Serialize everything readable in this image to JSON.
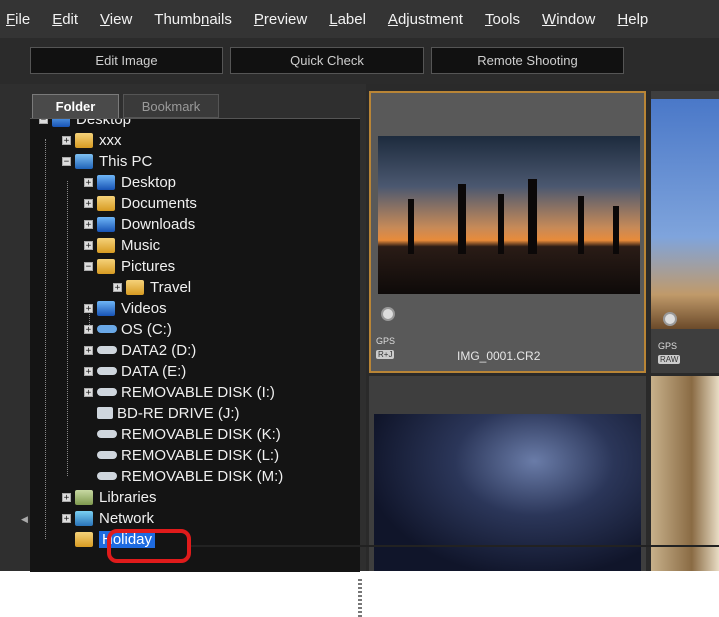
{
  "menu": [
    {
      "pre": "",
      "u": "F",
      "post": "ile"
    },
    {
      "pre": "",
      "u": "E",
      "post": "dit"
    },
    {
      "pre": "",
      "u": "V",
      "post": "iew"
    },
    {
      "pre": "Thumb",
      "u": "n",
      "post": "ails"
    },
    {
      "pre": "",
      "u": "P",
      "post": "review"
    },
    {
      "pre": "",
      "u": "L",
      "post": "abel"
    },
    {
      "pre": "",
      "u": "A",
      "post": "djustment"
    },
    {
      "pre": "",
      "u": "T",
      "post": "ools"
    },
    {
      "pre": "",
      "u": "W",
      "post": "indow"
    },
    {
      "pre": "",
      "u": "H",
      "post": "elp"
    }
  ],
  "toolbar": {
    "edit_image": "Edit Image",
    "quick_check": "Quick Check",
    "remote_shooting": "Remote Shooting"
  },
  "tabs": {
    "folder": "Folder",
    "bookmark": "Bookmark"
  },
  "tree": [
    {
      "label": "Desktop"
    },
    {
      "label": "xxx"
    },
    {
      "label": "This PC"
    },
    {
      "label": "Desktop"
    },
    {
      "label": "Documents"
    },
    {
      "label": "Downloads"
    },
    {
      "label": "Music"
    },
    {
      "label": "Pictures"
    },
    {
      "label": "Travel"
    },
    {
      "label": "Videos"
    },
    {
      "label": "OS (C:)"
    },
    {
      "label": "DATA2 (D:)"
    },
    {
      "label": "DATA (E:)"
    },
    {
      "label": "REMOVABLE DISK (I:)"
    },
    {
      "label": "BD-RE DRIVE (J:)"
    },
    {
      "label": "REMOVABLE DISK (K:)"
    },
    {
      "label": "REMOVABLE DISK (L:)"
    },
    {
      "label": "REMOVABLE DISK (M:)"
    },
    {
      "label": "Libraries"
    },
    {
      "label": "Network"
    },
    {
      "label": "Holiday"
    }
  ],
  "thumbnails": [
    {
      "filename": "IMG_0001.CR2",
      "gps": "GPS",
      "badge": "R+J"
    },
    {
      "filename": "",
      "gps": "GPS",
      "badge": "RAW"
    },
    {
      "filename": "",
      "gps": "",
      "badge": ""
    },
    {
      "filename": "",
      "gps": "",
      "badge": ""
    }
  ],
  "colors": {
    "highlight": "#1e6be0",
    "callout": "#e01b1b",
    "selected_border": "#b98536"
  }
}
